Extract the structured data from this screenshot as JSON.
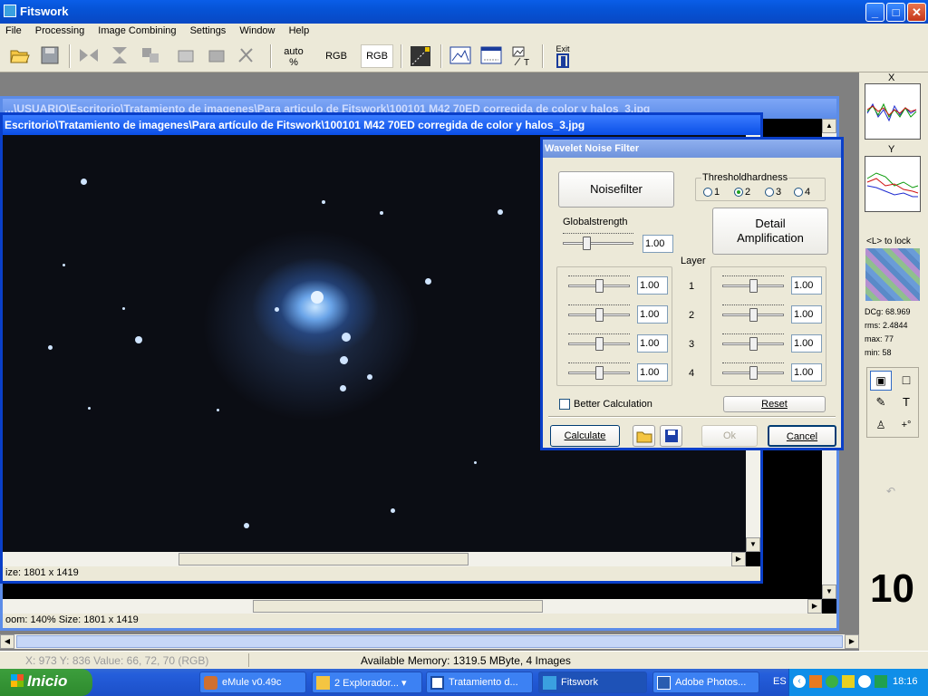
{
  "app": {
    "title": "Fitswork"
  },
  "menu": [
    "File",
    "Processing",
    "Image Combining",
    "Settings",
    "Window",
    "Help"
  ],
  "toolbar": {
    "auto_label": "auto",
    "auto_unit": "%",
    "rgb1": "RGB",
    "rgb2": "RGB",
    "exit_label": "Exit"
  },
  "image_windows": {
    "back": {
      "title": "...\\USUARIO\\Escritorio\\Tratamiento de imagenes\\Para articulo de Fitswork\\100101 M42 70ED corregida de color y halos_3.jpg",
      "status": "oom: 140%    Size: 1801 x 1419"
    },
    "front": {
      "title": "Escritorio\\Tratamiento de imagenes\\Para artículo de Fitswork\\100101 M42 70ED corregida de color y halos_3.jpg",
      "status": "ize: 1801 x 1419"
    }
  },
  "dialog": {
    "title": "Wavelet Noise Filter",
    "noisefilter": "Noisefilter",
    "threshold_label": "Thresholdhardness",
    "threshold_options": [
      "1",
      "2",
      "3",
      "4"
    ],
    "threshold_selected": "2",
    "global_label": "Globalstrength",
    "global_value": "1.00",
    "detail_label_1": "Detail",
    "detail_label_2": "Amplification",
    "layer_label": "Layer",
    "layers": [
      "1",
      "2",
      "3",
      "4"
    ],
    "noise_values": [
      "1.00",
      "1.00",
      "1.00",
      "1.00"
    ],
    "detail_values": [
      "1.00",
      "1.00",
      "1.00",
      "1.00"
    ],
    "better_calc": "Better Calculation",
    "reset": "Reset",
    "calculate": "Calculate",
    "ok": "Ok",
    "cancel": "Cancel"
  },
  "right_panel": {
    "x_label": "X",
    "y_label": "Y",
    "lock_label": "<L> to lock",
    "dcg": "DCg: 68.969",
    "rms": "rms: 2.4844",
    "max": "max: 77",
    "min": "min: 58",
    "big_number": "10"
  },
  "statusbar": {
    "coords": "X: 973  Y: 836  Value: 66, 72, 70 (RGB)",
    "memory": "Available Memory: 1319.5 MByte, 4 Images"
  },
  "taskbar": {
    "start": "Inicio",
    "tasks": [
      "eMule v0.49c",
      "2 Explorador...",
      "Tratamiento d...",
      "Fitswork",
      "Adobe Photos..."
    ],
    "lang": "ES",
    "clock": "18:16"
  }
}
